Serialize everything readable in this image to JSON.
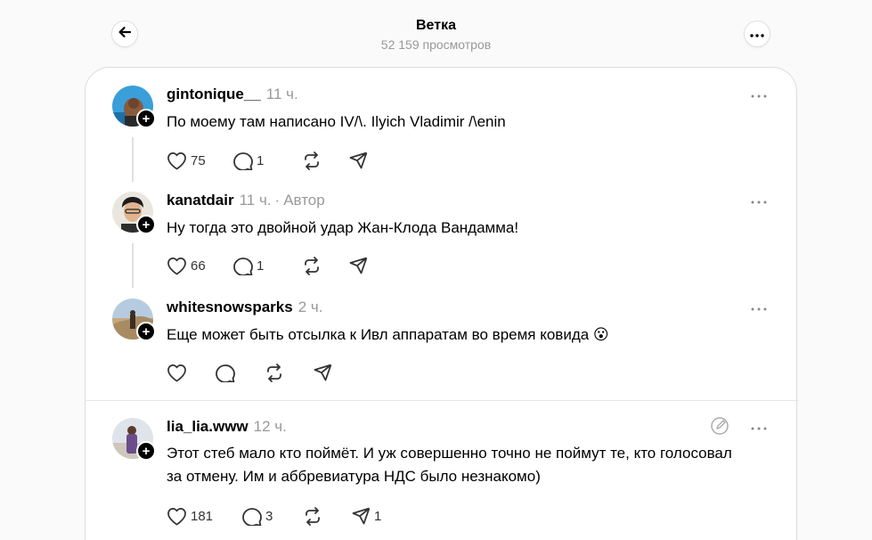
{
  "header": {
    "title": "Ветка",
    "views": "52 159 просмотров"
  },
  "posts": [
    {
      "username": "gintonique__",
      "time": "11 ч.",
      "author_tag": "",
      "text": "По моему там написано IV/\\. Ilyich Vladimir /\\enin",
      "likes": "75",
      "replies": "1",
      "reposts": "",
      "shares": ""
    },
    {
      "username": "kanatdair",
      "time": "11 ч.",
      "author_tag": "Автор",
      "text": "Ну тогда это двойной удар Жан-Клода Вандамма!",
      "likes": "66",
      "replies": "1",
      "reposts": "",
      "shares": ""
    },
    {
      "username": "whitesnowsparks",
      "time": "2 ч.",
      "author_tag": "",
      "text": "Еще может быть отсылка к Ивл аппаратам во время ковида 😮",
      "likes": "",
      "replies": "",
      "reposts": "",
      "shares": ""
    },
    {
      "username": "lia_lia.www",
      "time": "12 ч.",
      "author_tag": "",
      "text": "Этот стеб мало кто поймёт. И уж совершенно точно не поймут те, кто голосовал за отмену. Им и аббревиатура НДС было незнакомо)",
      "likes": "181",
      "replies": "3",
      "reposts": "",
      "shares": "1"
    }
  ],
  "icons": {
    "back": "arrow-left-icon",
    "more": "ellipsis-icon",
    "like": "heart-icon",
    "reply": "comment-icon",
    "repost": "repost-icon",
    "share": "send-icon",
    "follow": "plus-icon",
    "edited": "edit-icon"
  },
  "colors": {
    "background": "#fafafa",
    "card": "#ffffff",
    "muted_text": "#999999",
    "text": "#000000"
  }
}
